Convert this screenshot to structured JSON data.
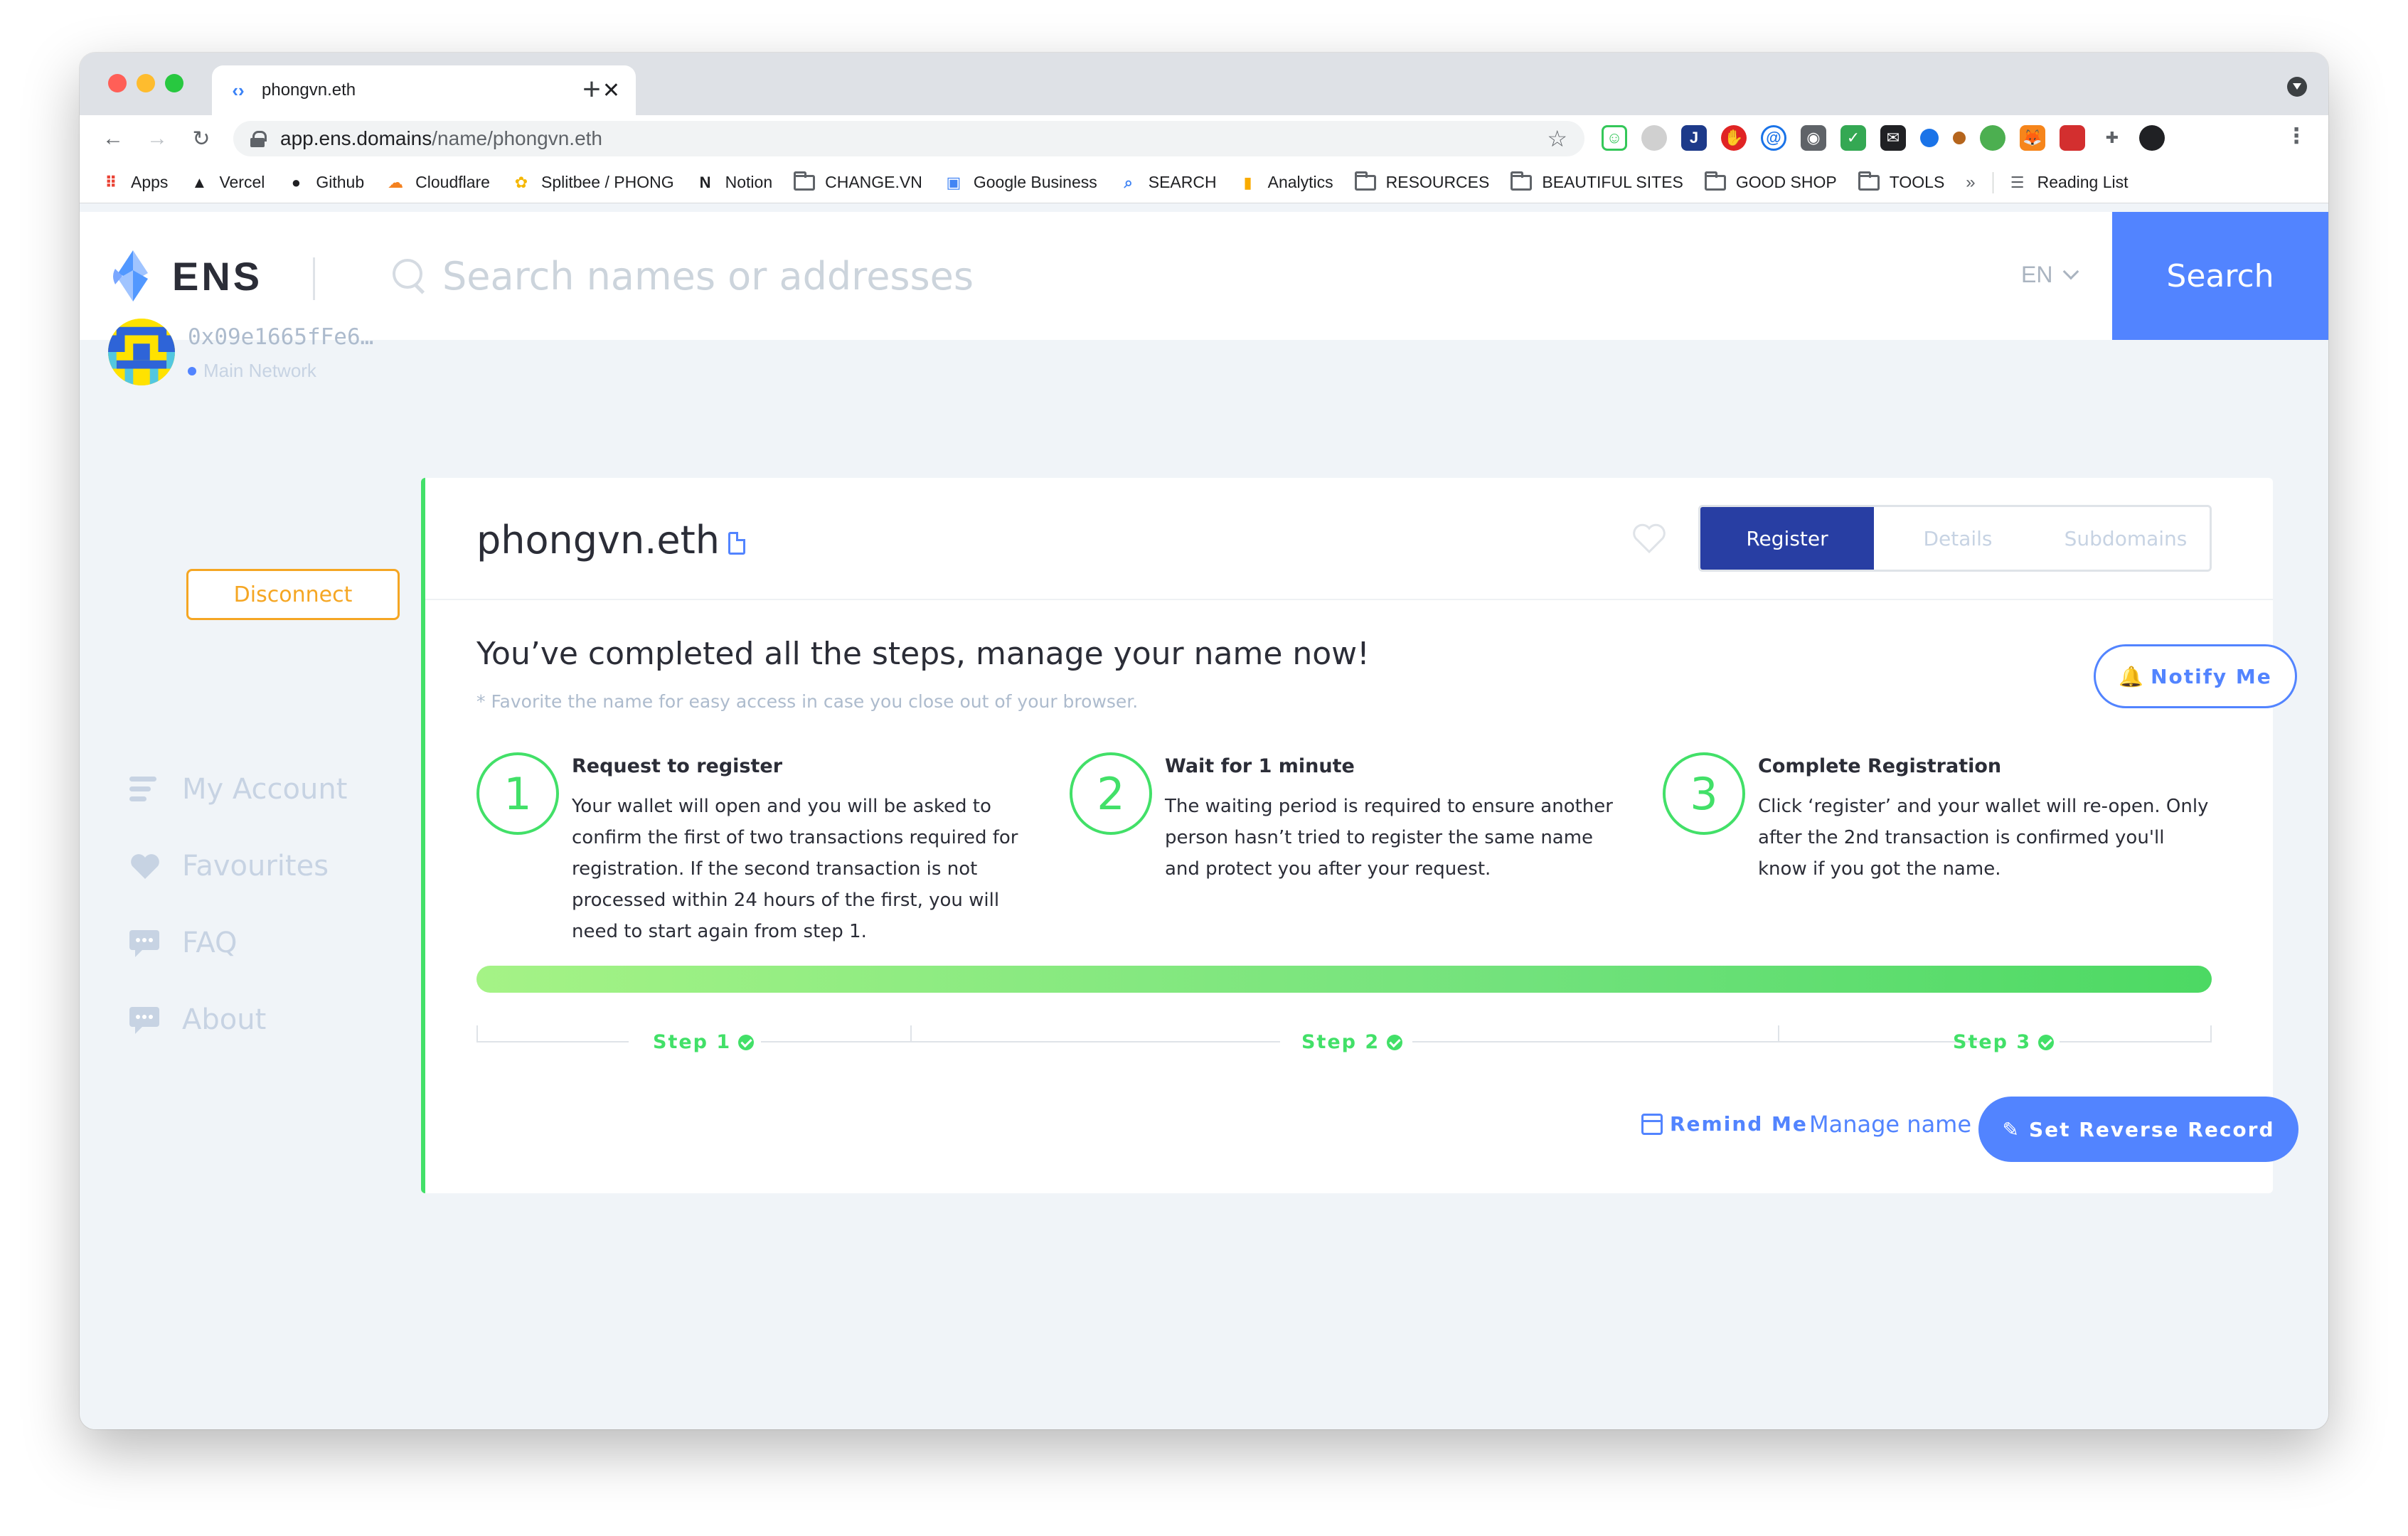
{
  "browser": {
    "tab_title": "phongvn.eth",
    "url_host": "app.ens.domains",
    "url_path": "/name/phongvn.eth",
    "bookmarks": [
      {
        "label": "Apps",
        "icon": "apps-grid-icon"
      },
      {
        "label": "Vercel",
        "icon": "vercel-icon"
      },
      {
        "label": "Github",
        "icon": "github-icon"
      },
      {
        "label": "Cloudflare",
        "icon": "cloudflare-icon"
      },
      {
        "label": "Splitbee / PHONG",
        "icon": "splitbee-icon"
      },
      {
        "label": "Notion",
        "icon": "notion-icon"
      },
      {
        "label": "CHANGE.VN",
        "icon": "folder-icon"
      },
      {
        "label": "Google Business",
        "icon": "google-business-icon"
      },
      {
        "label": "SEARCH",
        "icon": "search-bookmark-icon"
      },
      {
        "label": "Analytics",
        "icon": "analytics-icon"
      },
      {
        "label": "RESOURCES",
        "icon": "folder-icon"
      },
      {
        "label": "BEAUTIFUL SITES",
        "icon": "folder-icon"
      },
      {
        "label": "GOOD SHOP",
        "icon": "folder-icon"
      },
      {
        "label": "TOOLS",
        "icon": "folder-icon"
      }
    ],
    "bookmarks_more": "»",
    "reading_list": "Reading List"
  },
  "header": {
    "logo_text": "ENS",
    "search_placeholder": "Search names or addresses",
    "language": "EN",
    "search_button": "Search",
    "brand_color": "#5284ff"
  },
  "account": {
    "address": "0x09e1665fFe6…",
    "network": "Main Network",
    "disconnect_label": "Disconnect"
  },
  "sidebar": {
    "items": [
      {
        "label": "My Account",
        "icon": "list-icon"
      },
      {
        "label": "Favourites",
        "icon": "heart-icon"
      },
      {
        "label": "FAQ",
        "icon": "chat-icon"
      },
      {
        "label": "About",
        "icon": "chat-icon"
      }
    ]
  },
  "name_card": {
    "domain": "phongvn.eth",
    "tabs": [
      "Register",
      "Details",
      "Subdomains"
    ],
    "active_tab": "Register",
    "completed_title": "You’ve completed all the steps, manage your name now!",
    "favorite_note": "* Favorite the name for easy access in case you close out of your browser.",
    "notify_label": "Notify Me",
    "steps": [
      {
        "number": "1",
        "title": "Request to register",
        "text": "Your wallet will open and you will be asked to confirm the first of two transactions required for registration. If the second transaction is not processed within 24 hours of the first, you will need to start again from step 1."
      },
      {
        "number": "2",
        "title": "Wait for 1 minute",
        "text": "The waiting period is required to ensure another person hasn’t tried to register the same name and protect you after your request."
      },
      {
        "number": "3",
        "title": "Complete Registration",
        "text": "Click ‘register’ and your wallet will re-open. Only after the 2nd transaction is confirmed you'll know if you got the name."
      }
    ],
    "progress": 1.0,
    "step_labels": [
      "Step 1",
      "Step 2",
      "Step 3"
    ],
    "remind_label": "Remind Me",
    "manage_label": "Manage name",
    "reverse_label": "Set Reverse Record",
    "success_color": "#42e068"
  }
}
